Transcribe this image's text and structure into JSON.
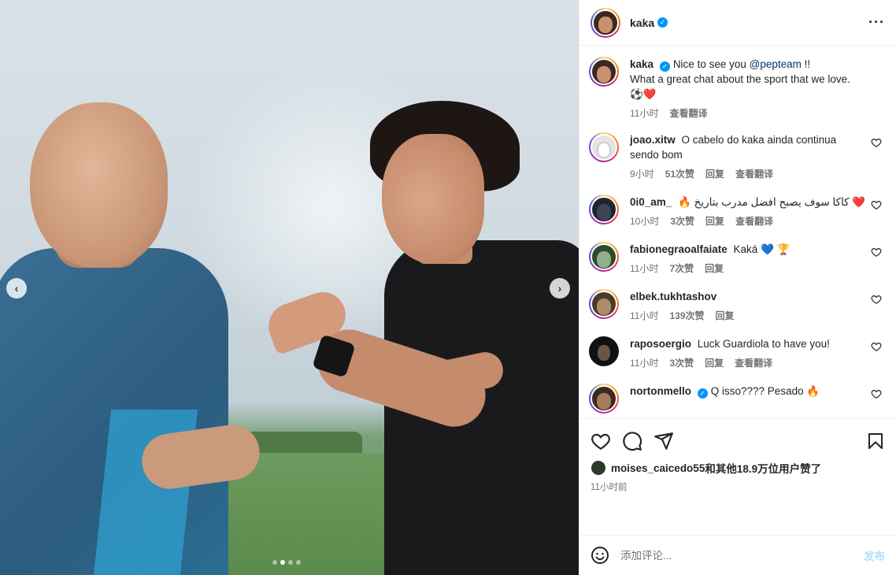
{
  "post": {
    "author": "kaka",
    "more_icon": "more-horizontal-icon",
    "dots_total": 4,
    "dots_active": 1
  },
  "caption": {
    "username": "kaka",
    "text_before": "Nice to see you ",
    "mention": "@pepteam",
    "text_after": " !!",
    "line2": "What a great chat about the sport that we love.",
    "emoji": "⚽️❤️",
    "time": "11小时",
    "translate": "查看翻译"
  },
  "comments": [
    {
      "username": "joao.xitw",
      "text": "O cabelo do kaka ainda continua sendo bom",
      "time": "9小时",
      "likes": "51次赞",
      "reply": "回复",
      "translate": "查看翻译",
      "avatar_color": "#d8d8d8"
    },
    {
      "username": "0i0_am_",
      "text": "🔥 كاكا سوف يصبح افضل مدرب بتاريخ ❤️",
      "time": "10小时",
      "likes": "3次赞",
      "reply": "回复",
      "translate": "查看翻译",
      "avatar_color": "#1f2430"
    },
    {
      "username": "fabionegraoalfaiate",
      "text": "Kaká 💙 🏆",
      "time": "11小时",
      "likes": "7次赞",
      "reply": "回复",
      "translate": "",
      "avatar_color": "#2c4a2c"
    },
    {
      "username": "elbek.tukhtashov",
      "text": "",
      "time": "11小时",
      "likes": "139次赞",
      "reply": "回复",
      "translate": "",
      "avatar_color": "#4a3a2a"
    },
    {
      "username": "raposoergio",
      "text": "Luck Guardiola to have you!",
      "time": "11小时",
      "likes": "3次赞",
      "reply": "回复",
      "translate": "查看翻译",
      "avatar_color": "#111111"
    },
    {
      "username": "nortonmello",
      "text": "Q isso???? Pesado 🔥",
      "time": "",
      "likes": "",
      "reply": "",
      "translate": "",
      "avatar_color": "#3a2a20",
      "verified": true
    }
  ],
  "likes_line": {
    "user": "moises_caicedo55",
    "rest": "和其他18.9万位用户赞了"
  },
  "posted_time": "11小时前",
  "add_comment": {
    "placeholder": "添加评论...",
    "post_label": "发布"
  },
  "colors": {
    "accent": "#0095f6",
    "verified": "#0095f6"
  }
}
